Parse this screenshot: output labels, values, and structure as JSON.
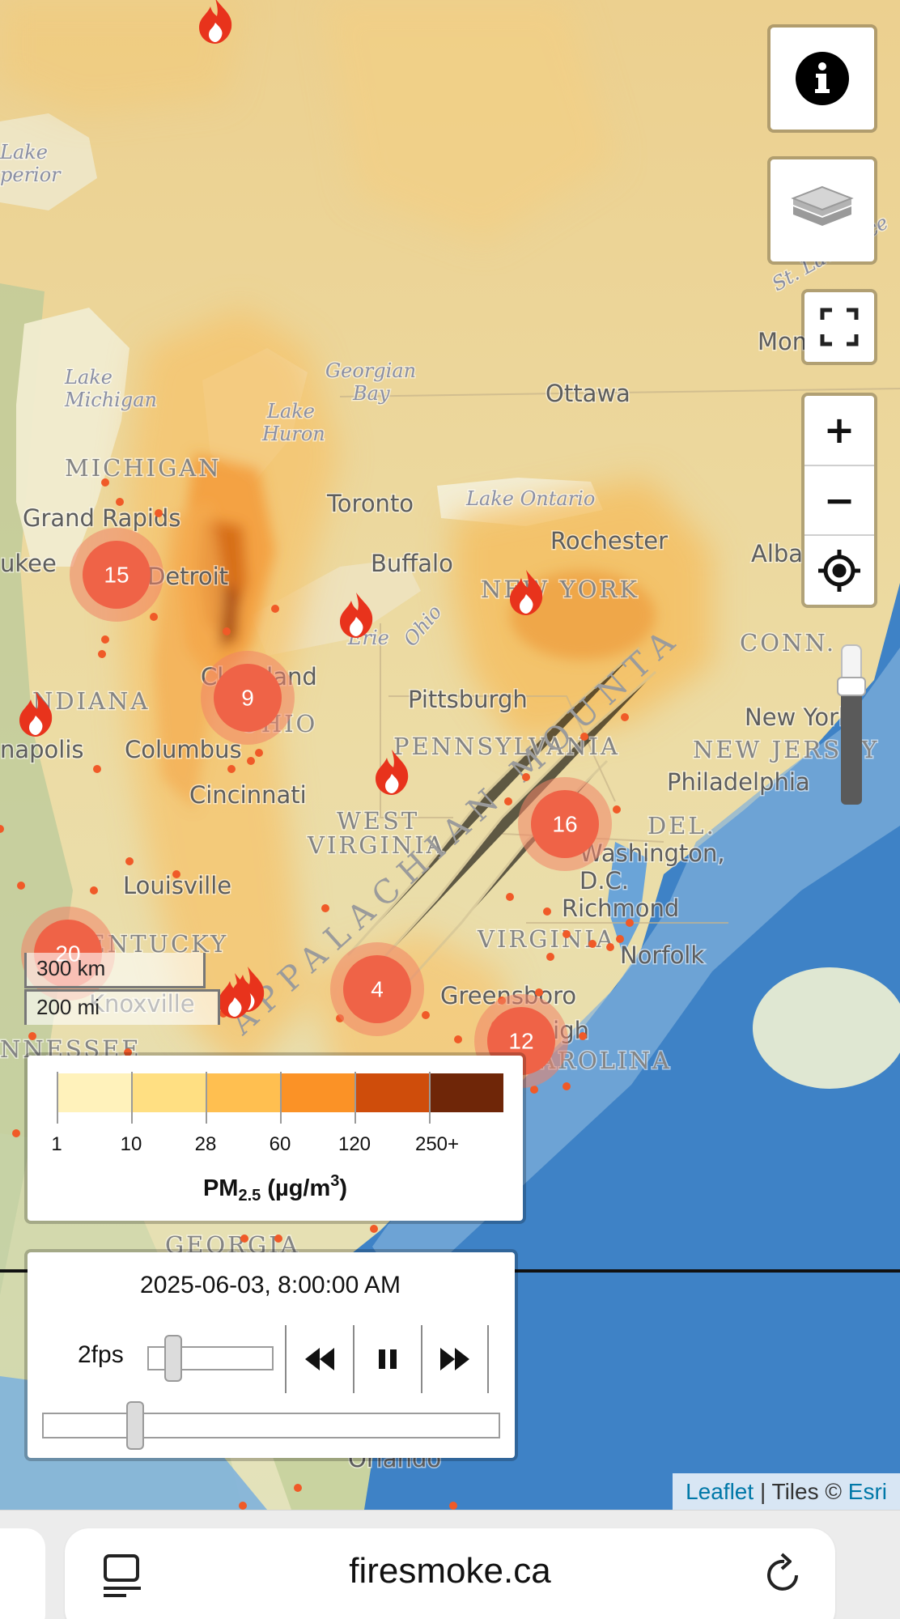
{
  "map": {
    "place_labels": [
      {
        "id": "grand-rapids",
        "text": "Grand Rapids",
        "kind": "city"
      },
      {
        "id": "detroit",
        "text": "Detroit",
        "kind": "city"
      },
      {
        "id": "toronto",
        "text": "Toronto",
        "kind": "city"
      },
      {
        "id": "buffalo",
        "text": "Buffalo",
        "kind": "city"
      },
      {
        "id": "rochester",
        "text": "Rochester",
        "kind": "city"
      },
      {
        "id": "ottawa",
        "text": "Ottawa",
        "kind": "city"
      },
      {
        "id": "cleveland",
        "text": "Cleveland",
        "kind": "city"
      },
      {
        "id": "columbus",
        "text": "Columbus",
        "kind": "city"
      },
      {
        "id": "pittsburgh",
        "text": "Pittsburgh",
        "kind": "city"
      },
      {
        "id": "cincinnati",
        "text": "Cincinnati",
        "kind": "city"
      },
      {
        "id": "louisville",
        "text": "Louisville",
        "kind": "city"
      },
      {
        "id": "philadelphia",
        "text": "Philadelphia",
        "kind": "city"
      },
      {
        "id": "washington",
        "text": "Washington,",
        "kind": "city"
      },
      {
        "id": "dc",
        "text": "D.C.",
        "kind": "city"
      },
      {
        "id": "richmond",
        "text": "Richmond",
        "kind": "city"
      },
      {
        "id": "norfolk",
        "text": "Norfolk",
        "kind": "city"
      },
      {
        "id": "greensboro",
        "text": "Greensboro",
        "kind": "city"
      },
      {
        "id": "raleigh",
        "text": "Raleigh",
        "kind": "city"
      },
      {
        "id": "knoxville",
        "text": "Knoxville",
        "kind": "city"
      },
      {
        "id": "orlando",
        "text": "Orlando",
        "kind": "city"
      },
      {
        "id": "napolis",
        "text": "napolis",
        "kind": "city"
      },
      {
        "id": "albany",
        "text": "Alba",
        "kind": "city"
      },
      {
        "id": "montreal",
        "text": "Mon",
        "kind": "city"
      },
      {
        "id": "new-york",
        "text": "New York",
        "kind": "city"
      },
      {
        "id": "ukee",
        "text": "ukee",
        "kind": "city"
      },
      {
        "id": "michigan",
        "text": "MICHIGAN",
        "kind": "region"
      },
      {
        "id": "ohio",
        "text": "OHIO",
        "kind": "region"
      },
      {
        "id": "indiana",
        "text": "NDIANA",
        "kind": "region"
      },
      {
        "id": "pennsylvania",
        "text": "PENNSYLVANIA",
        "kind": "region"
      },
      {
        "id": "new-york-state",
        "text": "NEW YORK",
        "kind": "region"
      },
      {
        "id": "west-virginia-1",
        "text": "WEST",
        "kind": "region"
      },
      {
        "id": "west-virginia-2",
        "text": "VIRGINIA",
        "kind": "region"
      },
      {
        "id": "virginia",
        "text": "VIRGINIA",
        "kind": "region"
      },
      {
        "id": "kentucky",
        "text": "KENTUCKY",
        "kind": "region"
      },
      {
        "id": "new-jersey",
        "text": "NEW JERSEY",
        "kind": "region"
      },
      {
        "id": "conn",
        "text": "CONN.",
        "kind": "region"
      },
      {
        "id": "del",
        "text": "DEL.",
        "kind": "region"
      },
      {
        "id": "carolina",
        "text": "CAROLINA",
        "kind": "region"
      },
      {
        "id": "tennessee",
        "text": "NNESSEE",
        "kind": "region"
      },
      {
        "id": "georgia",
        "text": "GEORGIA",
        "kind": "region"
      },
      {
        "id": "appalachian",
        "text": "APPALACHIAN MOUNTA",
        "kind": "big"
      },
      {
        "id": "lake-michigan-1",
        "text": "Lake",
        "kind": "water"
      },
      {
        "id": "lake-michigan-2",
        "text": "Michigan",
        "kind": "water"
      },
      {
        "id": "lake-huron-1",
        "text": "Lake",
        "kind": "water"
      },
      {
        "id": "lake-huron-2",
        "text": "Huron",
        "kind": "water"
      },
      {
        "id": "georgian-bay-1",
        "text": "Georgian",
        "kind": "water"
      },
      {
        "id": "georgian-bay-2",
        "text": "Bay",
        "kind": "water"
      },
      {
        "id": "lake-ontario",
        "text": "Lake Ontario",
        "kind": "water"
      },
      {
        "id": "lake-erie",
        "text": "Erie",
        "kind": "water"
      },
      {
        "id": "lake-superior-1",
        "text": "Lake",
        "kind": "water"
      },
      {
        "id": "lake-superior-2",
        "text": "perior",
        "kind": "water"
      },
      {
        "id": "st-lawrence",
        "text": "St. Lawrence",
        "kind": "water"
      },
      {
        "id": "ohio-river",
        "text": "Ohio",
        "kind": "water"
      }
    ],
    "clusters": [
      {
        "count": "15"
      },
      {
        "count": "9"
      },
      {
        "count": "16"
      },
      {
        "count": "20"
      },
      {
        "count": "4"
      },
      {
        "count": "12"
      }
    ],
    "fire_icon_count": 7,
    "colors": {
      "cluster": "#ef6347",
      "cluster_halo": "#f08466",
      "fire": "#e8331c",
      "hotspot": "#f05a28",
      "water": "#3f83c8"
    }
  },
  "controls": {
    "info_icon": "info-icon",
    "layers_icon": "layers-icon",
    "fullscreen_icon": "fullscreen-icon",
    "zoom_in": "+",
    "zoom_out": "−",
    "locate_icon": "crosshair-icon",
    "opacity_level": 0.85
  },
  "scale": {
    "km": "300 km",
    "mi": "200 mi"
  },
  "legend": {
    "labels": [
      "1",
      "10",
      "28",
      "60",
      "120",
      "250+"
    ],
    "colors": [
      "#fff2bb",
      "#ffdf82",
      "#ffbf50",
      "#fb9226",
      "#cf4d0b",
      "#6f2608"
    ],
    "title_main": "PM",
    "title_sub": "2.5",
    "title_units_open": " (µg/m",
    "title_sup": "3",
    "title_units_close": ")"
  },
  "time_control": {
    "timestamp": "2025-06-03, 8:00:00 AM",
    "fps": "2fps",
    "fps_fraction": 0.12,
    "time_fraction": 0.2,
    "back_icon": "backward-icon",
    "pause_icon": "pause-icon",
    "forward_icon": "forward-icon"
  },
  "attribution": {
    "leaflet": "Leaflet",
    "separator": " | Tiles © ",
    "esri": "Esri"
  },
  "browser": {
    "url": "firesmoke.ca",
    "left_icon": "tab-overview-icon",
    "reload_icon": "reload-icon"
  }
}
